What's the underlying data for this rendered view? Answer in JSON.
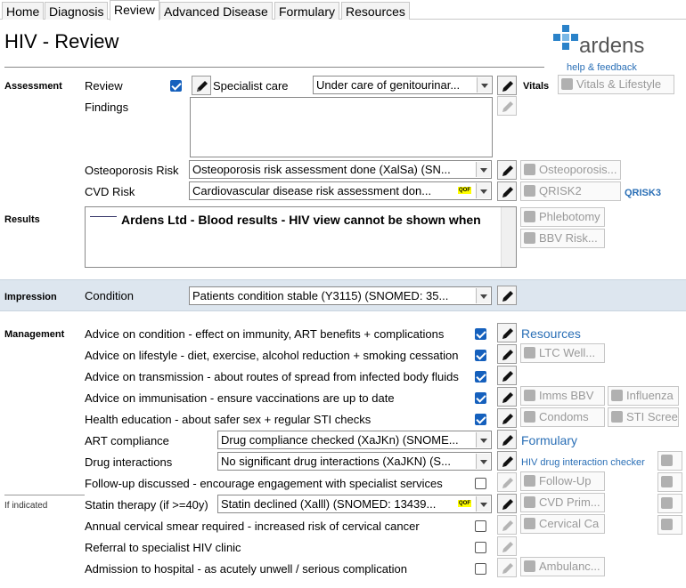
{
  "tabs": [
    "Home",
    "Diagnosis",
    "Review",
    "Advanced Disease",
    "Formulary",
    "Resources"
  ],
  "page_title": "HIV - Review",
  "logo": {
    "name": "ardens",
    "link": "help & feedback"
  },
  "sections": {
    "assessment": "Assessment",
    "results": "Results",
    "impression": "Impression",
    "management": "Management",
    "if_indicated": "If indicated",
    "vitals": "Vitals"
  },
  "assessment": {
    "review_label": "Review",
    "specialist_care_label": "Specialist care",
    "specialist_care_value": "Under care of genitourinar...",
    "findings_label": "Findings",
    "osteoporosis_label": "Osteoporosis Risk",
    "osteoporosis_value": "Osteoporosis risk assessment done (XalSa) (SN...",
    "cvd_label": "CVD Risk",
    "cvd_value": "Cardiovascular disease risk assessment don...",
    "qof": "QOF"
  },
  "buttons": {
    "vitals_lifestyle": "Vitals & Lifestyle",
    "osteoporosis": "Osteoporosis...",
    "qrisk2": "QRISK2",
    "qrisk3": "QRISK3",
    "phlebotomy": "Phlebotomy",
    "bbv_risk": "BBV Risk..."
  },
  "results": {
    "text": "Ardens Ltd - Blood results - HIV view cannot be shown when"
  },
  "impression": {
    "condition_label": "Condition",
    "condition_value": "Patients condition stable (Y3115) (SNOMED: 35..."
  },
  "management": {
    "rows": [
      {
        "label": "Advice on condition - effect on immunity, ART benefits + complications",
        "checked": true
      },
      {
        "label": "Advice on lifestyle - diet, exercise, alcohol reduction + smoking cessation",
        "checked": true
      },
      {
        "label": "Advice on transmission - about routes of spread from infected body fluids",
        "checked": true
      },
      {
        "label": "Advice on immunisation - ensure vaccinations are up to date",
        "checked": true
      },
      {
        "label": "Health education - about safer sex + regular STI checks",
        "checked": true
      }
    ],
    "art_label": "ART compliance",
    "art_value": "Drug compliance checked (XaJKn) (SNOME...",
    "drug_label": "Drug interactions",
    "drug_value": "No significant drug interactions (XaJKN) (S...",
    "followup_label": "Follow-up discussed - encourage engagement with specialist services",
    "statin_label": "Statin therapy (if >=40y)",
    "statin_value": "Statin declined (Xalll) (SNOMED: 13439...",
    "smear_label": "Annual cervical smear required - increased risk of cervical cancer",
    "referral_label": "Referral to specialist HIV clinic",
    "admission_label": "Admission to hospital - as acutely unwell / serious complication"
  },
  "side": {
    "resources": "Resources",
    "ltc_well": "LTC Well...",
    "imms_bbv": "Imms BBV",
    "influenza": "Influenza",
    "condoms": "Condoms",
    "sti_screen": "STI Scree",
    "formulary": "Formulary",
    "hiv_checker": "HIV drug interaction checker",
    "follow_up": "Follow-Up",
    "cvd_prim": "CVD Prim...",
    "cervical_ca": "Cervical Ca",
    "ambulance": "Ambulanc..."
  },
  "colors": {
    "accent": "#1560bd",
    "link": "#2a6fb6",
    "band": "#dde6ef",
    "logo_blue": "#2a82c9"
  }
}
